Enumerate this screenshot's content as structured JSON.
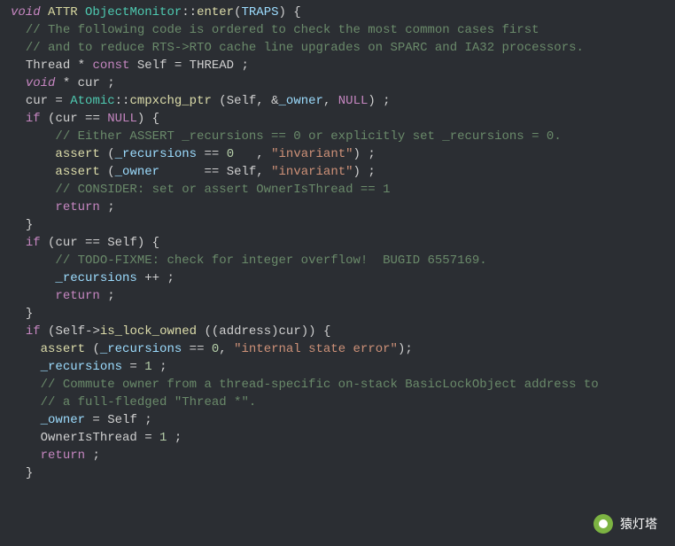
{
  "watermark": {
    "text": "猿灯塔"
  },
  "code": {
    "lines": [
      {
        "indent": 0,
        "tokens": [
          [
            "k-void",
            "void"
          ],
          [
            "sp",
            " "
          ],
          [
            "k-attr",
            "ATTR"
          ],
          [
            "sp",
            " "
          ],
          [
            "k-class",
            "ObjectMonitor"
          ],
          [
            "k-punc",
            "::"
          ],
          [
            "k-fn",
            "enter"
          ],
          [
            "k-punc",
            "("
          ],
          [
            "k-param",
            "TRAPS"
          ],
          [
            "k-punc",
            ") {"
          ]
        ]
      },
      {
        "indent": 1,
        "tokens": [
          [
            "k-cmt",
            "// The following code is ordered to check the most common cases first"
          ]
        ]
      },
      {
        "indent": 1,
        "tokens": [
          [
            "k-cmt",
            "// and to reduce RTS->RTO cache line upgrades on SPARC and IA32 processors."
          ]
        ]
      },
      {
        "indent": 1,
        "tokens": [
          [
            "k-ident",
            "Thread "
          ],
          [
            "k-punc",
            "*"
          ],
          [
            "sp",
            " "
          ],
          [
            "k-const",
            "const"
          ],
          [
            "sp",
            " "
          ],
          [
            "k-ident",
            "Self = THREAD ;"
          ]
        ]
      },
      {
        "indent": 1,
        "tokens": [
          [
            "k-void",
            "void"
          ],
          [
            "sp",
            " "
          ],
          [
            "k-punc",
            "*"
          ],
          [
            "sp",
            " "
          ],
          [
            "k-ident",
            "cur ;"
          ]
        ]
      },
      {
        "indent": 0,
        "tokens": [
          [
            "sp",
            ""
          ]
        ]
      },
      {
        "indent": 1,
        "tokens": [
          [
            "k-ident",
            "cur = "
          ],
          [
            "k-class",
            "Atomic"
          ],
          [
            "k-punc",
            "::"
          ],
          [
            "k-call",
            "cmpxchg_ptr"
          ],
          [
            "sp",
            " "
          ],
          [
            "k-punc",
            "("
          ],
          [
            "k-ident",
            "Self, "
          ],
          [
            "k-punc",
            "&"
          ],
          [
            "k-member",
            "_owner"
          ],
          [
            "k-ident",
            ", "
          ],
          [
            "k-null",
            "NULL"
          ],
          [
            "k-punc",
            ") ;"
          ]
        ]
      },
      {
        "indent": 1,
        "tokens": [
          [
            "k-if",
            "if"
          ],
          [
            "sp",
            " "
          ],
          [
            "k-punc",
            "("
          ],
          [
            "k-ident",
            "cur == "
          ],
          [
            "k-null",
            "NULL"
          ],
          [
            "k-punc",
            ") {"
          ]
        ]
      },
      {
        "indent": 3,
        "tokens": [
          [
            "k-cmt",
            "// Either ASSERT _recursions == 0 or explicitly set _recursions = 0."
          ]
        ]
      },
      {
        "indent": 3,
        "tokens": [
          [
            "k-call",
            "assert"
          ],
          [
            "sp",
            " "
          ],
          [
            "k-punc",
            "("
          ],
          [
            "k-member",
            "_recursions"
          ],
          [
            "k-ident",
            " == "
          ],
          [
            "k-num",
            "0"
          ],
          [
            "k-ident",
            "   , "
          ],
          [
            "k-str",
            "\"invariant\""
          ],
          [
            "k-punc",
            ") ;"
          ]
        ]
      },
      {
        "indent": 3,
        "tokens": [
          [
            "k-call",
            "assert"
          ],
          [
            "sp",
            " "
          ],
          [
            "k-punc",
            "("
          ],
          [
            "k-member",
            "_owner"
          ],
          [
            "k-ident",
            "      == Self, "
          ],
          [
            "k-str",
            "\"invariant\""
          ],
          [
            "k-punc",
            ") ;"
          ]
        ]
      },
      {
        "indent": 3,
        "tokens": [
          [
            "k-cmt",
            "// CONSIDER: set or assert OwnerIsThread == 1"
          ]
        ]
      },
      {
        "indent": 3,
        "tokens": [
          [
            "k-return",
            "return"
          ],
          [
            "sp",
            " "
          ],
          [
            "k-punc",
            ";"
          ]
        ]
      },
      {
        "indent": 1,
        "tokens": [
          [
            "k-punc",
            "}"
          ]
        ]
      },
      {
        "indent": 0,
        "tokens": [
          [
            "sp",
            ""
          ]
        ]
      },
      {
        "indent": 1,
        "tokens": [
          [
            "k-if",
            "if"
          ],
          [
            "sp",
            " "
          ],
          [
            "k-punc",
            "("
          ],
          [
            "k-ident",
            "cur == Self"
          ],
          [
            "k-punc",
            ") {"
          ]
        ]
      },
      {
        "indent": 3,
        "tokens": [
          [
            "k-cmt",
            "// TODO-FIXME: check for integer overflow!  BUGID 6557169."
          ]
        ]
      },
      {
        "indent": 3,
        "tokens": [
          [
            "k-member",
            "_recursions"
          ],
          [
            "k-ident",
            " ++ ;"
          ]
        ]
      },
      {
        "indent": 3,
        "tokens": [
          [
            "k-return",
            "return"
          ],
          [
            "sp",
            " "
          ],
          [
            "k-punc",
            ";"
          ]
        ]
      },
      {
        "indent": 1,
        "tokens": [
          [
            "k-punc",
            "}"
          ]
        ]
      },
      {
        "indent": 0,
        "tokens": [
          [
            "sp",
            ""
          ]
        ]
      },
      {
        "indent": 1,
        "tokens": [
          [
            "k-if",
            "if"
          ],
          [
            "sp",
            " "
          ],
          [
            "k-punc",
            "("
          ],
          [
            "k-ident",
            "Self->"
          ],
          [
            "k-call",
            "is_lock_owned"
          ],
          [
            "sp",
            " "
          ],
          [
            "k-punc",
            "(("
          ],
          [
            "k-ident",
            "address"
          ],
          [
            "k-punc",
            ")"
          ],
          [
            "k-ident",
            "cur"
          ],
          [
            "k-punc",
            ")) {"
          ]
        ]
      },
      {
        "indent": 2,
        "tokens": [
          [
            "k-call",
            "assert"
          ],
          [
            "sp",
            " "
          ],
          [
            "k-punc",
            "("
          ],
          [
            "k-member",
            "_recursions"
          ],
          [
            "k-ident",
            " == "
          ],
          [
            "k-num",
            "0"
          ],
          [
            "k-ident",
            ", "
          ],
          [
            "k-str",
            "\"internal state error\""
          ],
          [
            "k-punc",
            ");"
          ]
        ]
      },
      {
        "indent": 2,
        "tokens": [
          [
            "k-member",
            "_recursions"
          ],
          [
            "k-ident",
            " = "
          ],
          [
            "k-num",
            "1"
          ],
          [
            "sp",
            " "
          ],
          [
            "k-punc",
            ";"
          ]
        ]
      },
      {
        "indent": 2,
        "tokens": [
          [
            "k-cmt",
            "// Commute owner from a thread-specific on-stack BasicLockObject address to"
          ]
        ]
      },
      {
        "indent": 2,
        "tokens": [
          [
            "k-cmt",
            "// a full-fledged \"Thread *\"."
          ]
        ]
      },
      {
        "indent": 2,
        "tokens": [
          [
            "k-member",
            "_owner"
          ],
          [
            "k-ident",
            " = Self ;"
          ]
        ]
      },
      {
        "indent": 2,
        "tokens": [
          [
            "k-ident",
            "OwnerIsThread = "
          ],
          [
            "k-num",
            "1"
          ],
          [
            "sp",
            " "
          ],
          [
            "k-punc",
            ";"
          ]
        ]
      },
      {
        "indent": 2,
        "tokens": [
          [
            "k-return",
            "return"
          ],
          [
            "sp",
            " "
          ],
          [
            "k-punc",
            ";"
          ]
        ]
      },
      {
        "indent": 1,
        "tokens": [
          [
            "k-punc",
            "}"
          ]
        ]
      }
    ]
  }
}
